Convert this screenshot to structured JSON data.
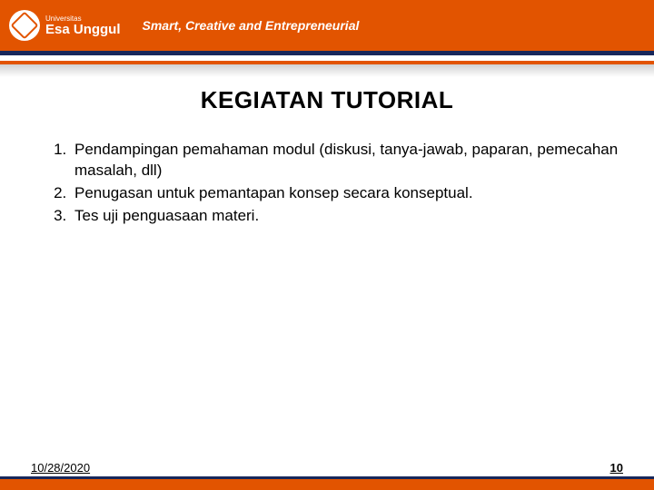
{
  "header": {
    "logo_small": "Universitas",
    "logo_big": "Esa Unggul",
    "tagline": "Smart, Creative and Entrepreneurial"
  },
  "main": {
    "title": "KEGIATAN TUTORIAL",
    "items": [
      "Pendampingan pemahaman modul (diskusi, tanya-jawab, paparan, pemecahan masalah, dll)",
      "Penugasan untuk pemantapan konsep secara konseptual.",
      "Tes uji penguasaan  materi."
    ]
  },
  "footer": {
    "date": "10/28/2020",
    "page": "10"
  }
}
